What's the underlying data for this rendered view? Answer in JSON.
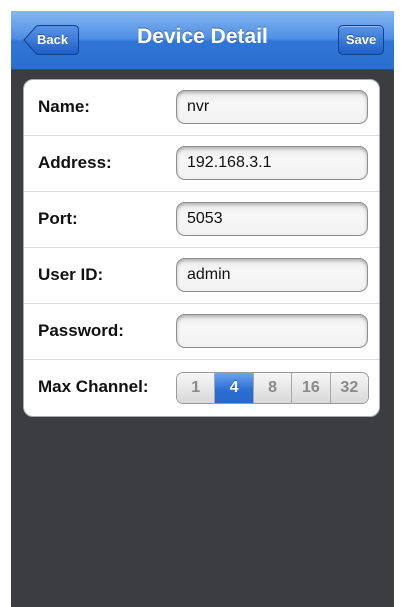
{
  "nav": {
    "title": "Device Detail",
    "back_label": "Back",
    "save_label": "Save"
  },
  "form": {
    "name": {
      "label": "Name:",
      "value": "nvr"
    },
    "address": {
      "label": "Address:",
      "value": "192.168.3.1"
    },
    "port": {
      "label": "Port:",
      "value": "5053"
    },
    "user_id": {
      "label": "User ID:",
      "value": "admin"
    },
    "password": {
      "label": "Password:",
      "value": ""
    },
    "max_channel": {
      "label": "Max Channel:",
      "options": [
        "1",
        "4",
        "8",
        "16",
        "32"
      ],
      "selected": "4"
    }
  },
  "colors": {
    "nav_blue": "#4d8ee5",
    "selected_segment": "#2d6fd4",
    "background": "#3b3d40"
  }
}
